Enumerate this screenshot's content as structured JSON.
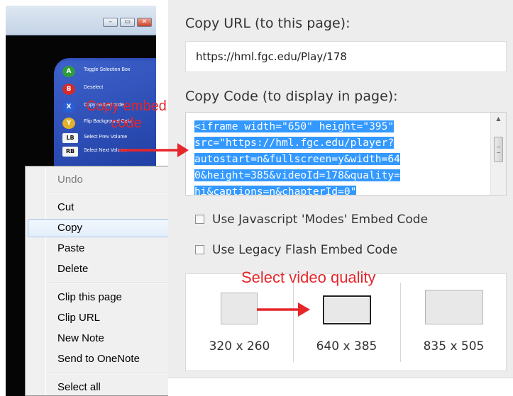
{
  "video_thumbnail": {
    "window_buttons": [
      "–",
      "▭",
      "✕"
    ],
    "controls": [
      {
        "badge": "A",
        "badge_color": "#2e9d3a",
        "label": "Toggle Selection Box"
      },
      {
        "badge": "B",
        "badge_color": "#d42a2a",
        "label": "Deselect"
      },
      {
        "badge": "X",
        "badge_color": "#2a5fd4",
        "label": "Copy embed code"
      },
      {
        "badge": "Y",
        "badge_color": "#e3b12a",
        "label": "Flip Background Color"
      },
      {
        "badge": "LB",
        "badge_color": "#f4f4f4",
        "label": "Select Prev Volume"
      },
      {
        "badge": "RB",
        "badge_color": "#f4f4f4",
        "label": "Select Next Volume"
      }
    ]
  },
  "annotations": {
    "copy_embed": "Copy embed code",
    "select_quality": "Select video quality",
    "color": "#e5262a"
  },
  "context_menu": {
    "items": [
      {
        "label": "Undo",
        "state": "disabled"
      },
      {
        "label": "Cut",
        "state": "normal"
      },
      {
        "label": "Copy",
        "state": "hover"
      },
      {
        "label": "Paste",
        "state": "normal"
      },
      {
        "label": "Delete",
        "state": "normal"
      },
      {
        "label": "Clip this page",
        "state": "normal"
      },
      {
        "label": "Clip URL",
        "state": "normal"
      },
      {
        "label": "New Note",
        "state": "normal"
      },
      {
        "label": "Send to OneNote",
        "state": "normal"
      },
      {
        "label": "Select all",
        "state": "normal"
      }
    ]
  },
  "embed_panel": {
    "copy_url_label": "Copy URL (to this page):",
    "url_value": "https://hml.fgc.edu/Play/178",
    "copy_code_label": "Copy Code (to display in page):",
    "code_lines": [
      "<iframe width=\"650\" height=\"395\"",
      "src=\"https://hml.fgc.edu/player?",
      "autostart=n&fullscreen=y&width=64",
      "0&height=385&videoId=178&quality=",
      "hi&captions=n&chapterId=0\""
    ],
    "options": [
      {
        "label": "Use Javascript 'Modes' Embed Code",
        "checked": false
      },
      {
        "label": "Use Legacy Flash Embed Code",
        "checked": false
      }
    ],
    "qualities": [
      {
        "label": "320 x 260",
        "selected": false
      },
      {
        "label": "640 x 385",
        "selected": true
      },
      {
        "label": "835 x 505",
        "selected": false
      }
    ],
    "selection_color": "#3399ff"
  }
}
